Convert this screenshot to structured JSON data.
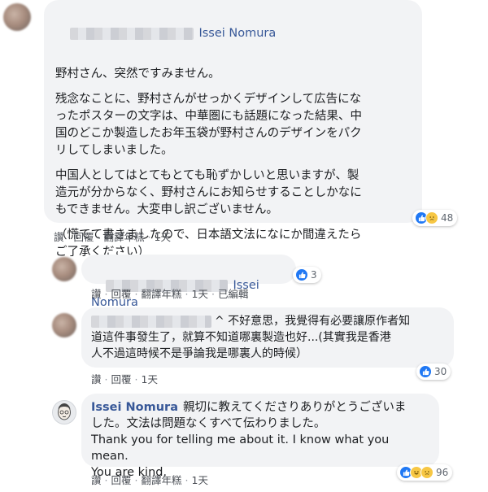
{
  "comments": [
    {
      "name": "Issei Nomura",
      "paragraphs": [
        "野村さん、突然ですみません。",
        "残念なことに、野村さんがせっかくデザインして広告にな\nったポスターの文字は、中華圏にも話題になった結果、中\n国のどこか製造したお年玉袋が野村さんのデザインをパク\nリしてしまいました。",
        "中国人としてはとてもとても恥ずかしいと思いますが、製\n造元が分からなく、野村さんにお知らせすることしかなに\nもできません。大変申し訳ございません。",
        "（慌てて書きましたので、日本語文法になにか間違えたら\nご了承ください）"
      ],
      "actions": [
        "讚",
        "回覆",
        "翻譯年糕",
        "1天"
      ],
      "reaction_count": "48"
    },
    {
      "name": "Issei Nomura",
      "actions": [
        "讚",
        "回覆",
        "翻譯年糕",
        "1天",
        "已編輯"
      ],
      "reaction_count": "3"
    },
    {
      "text": "^ 不好意思，我覺得有必要讓原作者知\n道這件事發生了，就算不知道哪裏製造也好...(其實我是香港\n人不過這時候不是爭論我是哪裏人的時候）",
      "actions": [
        "讚",
        "回覆",
        "1天"
      ],
      "reaction_count": "30"
    },
    {
      "name": "Issei Nomura",
      "text": "親切に教えてくださりありがとうございま\nした。文法は問題なくすべて伝わりました。\nThank you for telling me about it. I know what you mean.\nYou are kind.",
      "actions": [
        "讚",
        "回覆",
        "翻譯年糕",
        "1天"
      ],
      "reaction_count": "96"
    }
  ],
  "colors": {
    "name": "#385898",
    "bubble": "#f2f3f5",
    "like": "#2078f4",
    "haha": "#f7c744"
  },
  "icons": [
    "like-icon",
    "haha-icon",
    "sad-icon"
  ]
}
